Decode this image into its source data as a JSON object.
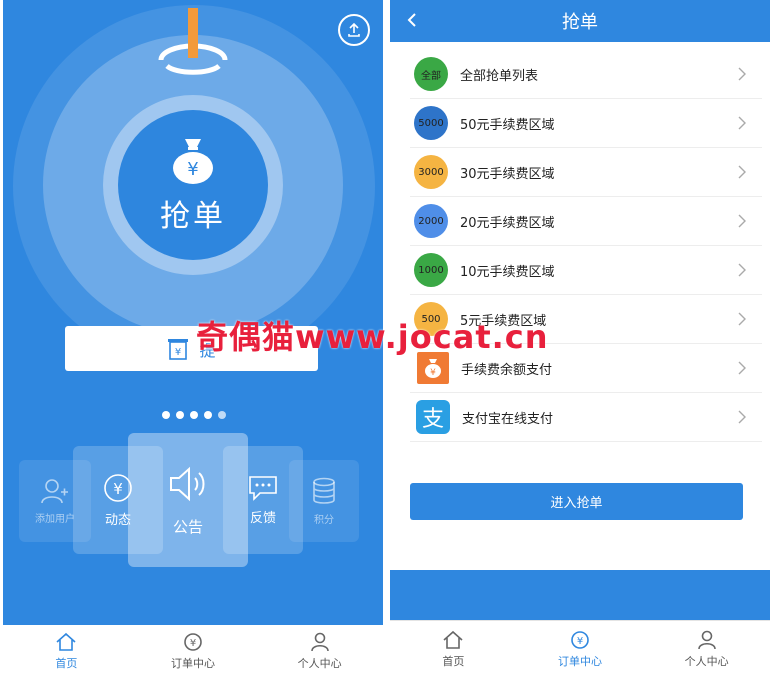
{
  "left": {
    "main_button_label": "抢单",
    "notice_partial": "提",
    "cards": {
      "add": "添加用户",
      "feed": "动态",
      "notice": "公告",
      "feedback": "反馈",
      "points": "积分"
    },
    "carousel": {
      "count": 5,
      "active_index": 4
    },
    "tabs": [
      {
        "label": "首页",
        "active": true
      },
      {
        "label": "订单中心",
        "active": false
      },
      {
        "label": "个人中心",
        "active": false
      }
    ]
  },
  "right": {
    "header_title": "抢单",
    "rows": [
      {
        "badge": "全部",
        "label": "全部抢单列表",
        "color": "#3aa845"
      },
      {
        "badge": "5000",
        "label": "50元手续费区域",
        "color": "#2e74c9"
      },
      {
        "badge": "3000",
        "label": "30元手续费区域",
        "color": "#f5b442"
      },
      {
        "badge": "2000",
        "label": "20元手续费区域",
        "color": "#4f8ee8"
      },
      {
        "badge": "1000",
        "label": "10元手续费区域",
        "color": "#3aa845"
      },
      {
        "badge": "500",
        "label": "5元手续费区域",
        "color": "#f5b442"
      },
      {
        "label": "手续费余额支付"
      },
      {
        "label": "支付宝在线支付"
      }
    ],
    "alipay_glyph": "支",
    "enter_button": "进入抢单",
    "tabs": [
      {
        "label": "首页",
        "active": false
      },
      {
        "label": "订单中心",
        "active": true
      },
      {
        "label": "个人中心",
        "active": false
      }
    ]
  },
  "watermark": "奇偶猫www.jocat.cn",
  "colors": {
    "primary": "#2f87df",
    "watermark": "#e8203c"
  }
}
